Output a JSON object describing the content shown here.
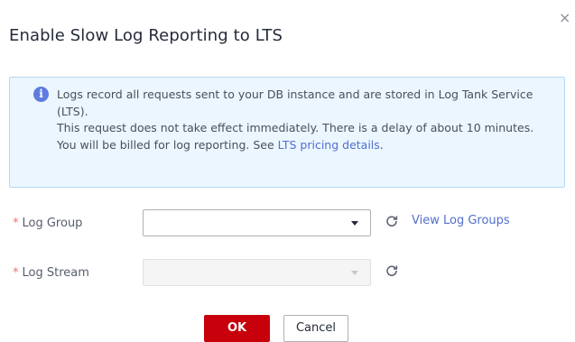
{
  "dialog": {
    "title": "Enable Slow Log Reporting to LTS",
    "close_glyph": "×"
  },
  "notice": {
    "icon": "info-icon",
    "line1": "Logs record all requests sent to your DB instance and are stored in Log Tank Service (LTS).",
    "line2": "This request does not take effect immediately. There is a delay of about 10 minutes.",
    "line3_prefix": "You will be billed for log reporting. See ",
    "line3_link": "LTS pricing details",
    "line3_suffix": "."
  },
  "form": {
    "required_mark": "*",
    "log_group": {
      "label": "Log Group",
      "value": "",
      "refresh_icon": "refresh-icon",
      "link": "View Log Groups"
    },
    "log_stream": {
      "label": "Log Stream",
      "value": "",
      "disabled": true,
      "refresh_icon": "refresh-icon"
    }
  },
  "buttons": {
    "ok": "OK",
    "cancel": "Cancel"
  },
  "colors": {
    "primary": "#c7000b",
    "link": "#526ecc",
    "info_bg": "#ebf6ff",
    "required": "#f66f6a"
  }
}
